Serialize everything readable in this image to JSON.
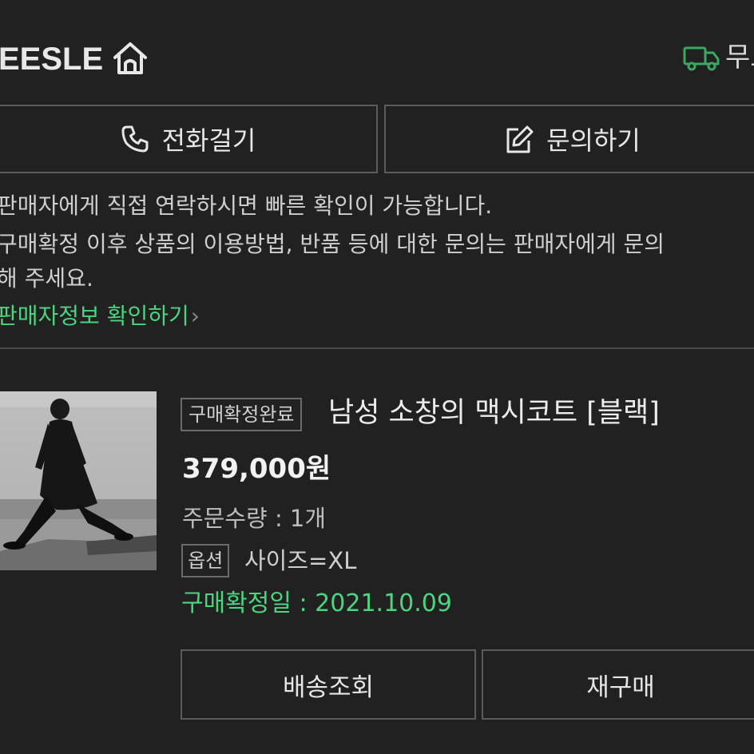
{
  "store": {
    "name": "EESLE",
    "shipping_text": "무료"
  },
  "contact": {
    "call_label": "전화걸기",
    "inquiry_label": "문의하기"
  },
  "notice": {
    "line1": "판매자에게 직접 연락하시면 빠른 확인이 가능합니다.",
    "line2": "구매확정 이후 상품의 이용방법, 반품 등에 대한 문의는 판매자에게 문의",
    "line3": "해 주세요.",
    "seller_link": "판매자정보 확인하기",
    "seller_link_chevron": "›"
  },
  "order": {
    "status": "구매확정완료",
    "title": "남성 소창의 맥시코트 [블랙]",
    "price": "379,000원",
    "quantity": "주문수량 : 1개",
    "option_label": "옵션",
    "option_value": "사이즈=XL",
    "confirm_date": "구매확정일 : 2021.10.09",
    "track_label": "배송조회",
    "rebuy_label": "재구매"
  },
  "colors": {
    "background": "#212121",
    "accent_green": "#4cd57f",
    "border": "#5b5b5b"
  },
  "icons": [
    "home-icon",
    "truck-icon",
    "phone-icon",
    "edit-icon",
    "chevron-right-icon"
  ]
}
